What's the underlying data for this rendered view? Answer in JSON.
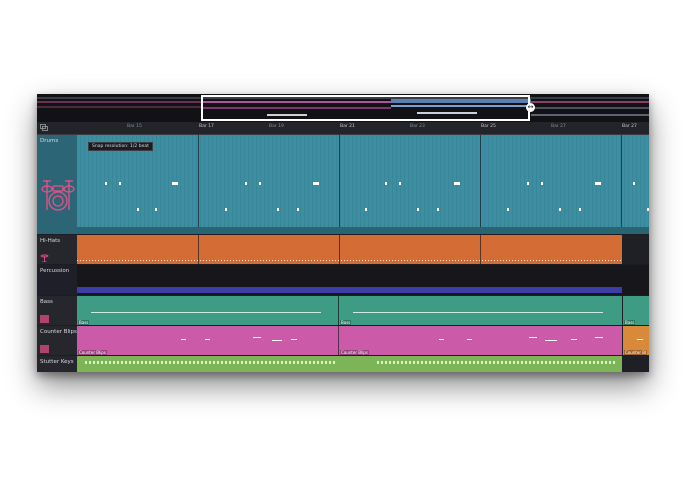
{
  "timeline": {
    "bar_labels": [
      "Bar 15",
      "Bar 17",
      "Bar 19",
      "Bar 21",
      "Bar 23",
      "Bar 25",
      "Bar 27"
    ],
    "major_labels": [
      "Bar 17",
      "Bar 21",
      "Bar 23",
      "Bar 27"
    ]
  },
  "tooltip": "Snap resolution: 1/2 beat",
  "tracks": [
    {
      "name": "Drums",
      "color": "#3f8fa2",
      "clip_label": ""
    },
    {
      "name": "Hi-Hats",
      "color": "#d66d36",
      "clip_label": ""
    },
    {
      "name": "Percussion",
      "color": "#3c3fa6",
      "clip_label": ""
    },
    {
      "name": "Bass",
      "color": "#3f9c84",
      "clip_label": "Bass"
    },
    {
      "name": "Counter Blips",
      "color": "#cc5aa8",
      "clip_label": "Counter Blips"
    },
    {
      "name": "Stutter Keys",
      "color": "#7db557",
      "clip_label": ""
    }
  ],
  "icons": {
    "ruler": "timeline-zoom-icon",
    "drums": "drum-kit-icon",
    "hihats": "hihat-icon",
    "bass": "waveform-icon",
    "counter": "waveform-icon",
    "stutter": "waveform-icon"
  },
  "counter_tail_label": "Counter Bl"
}
